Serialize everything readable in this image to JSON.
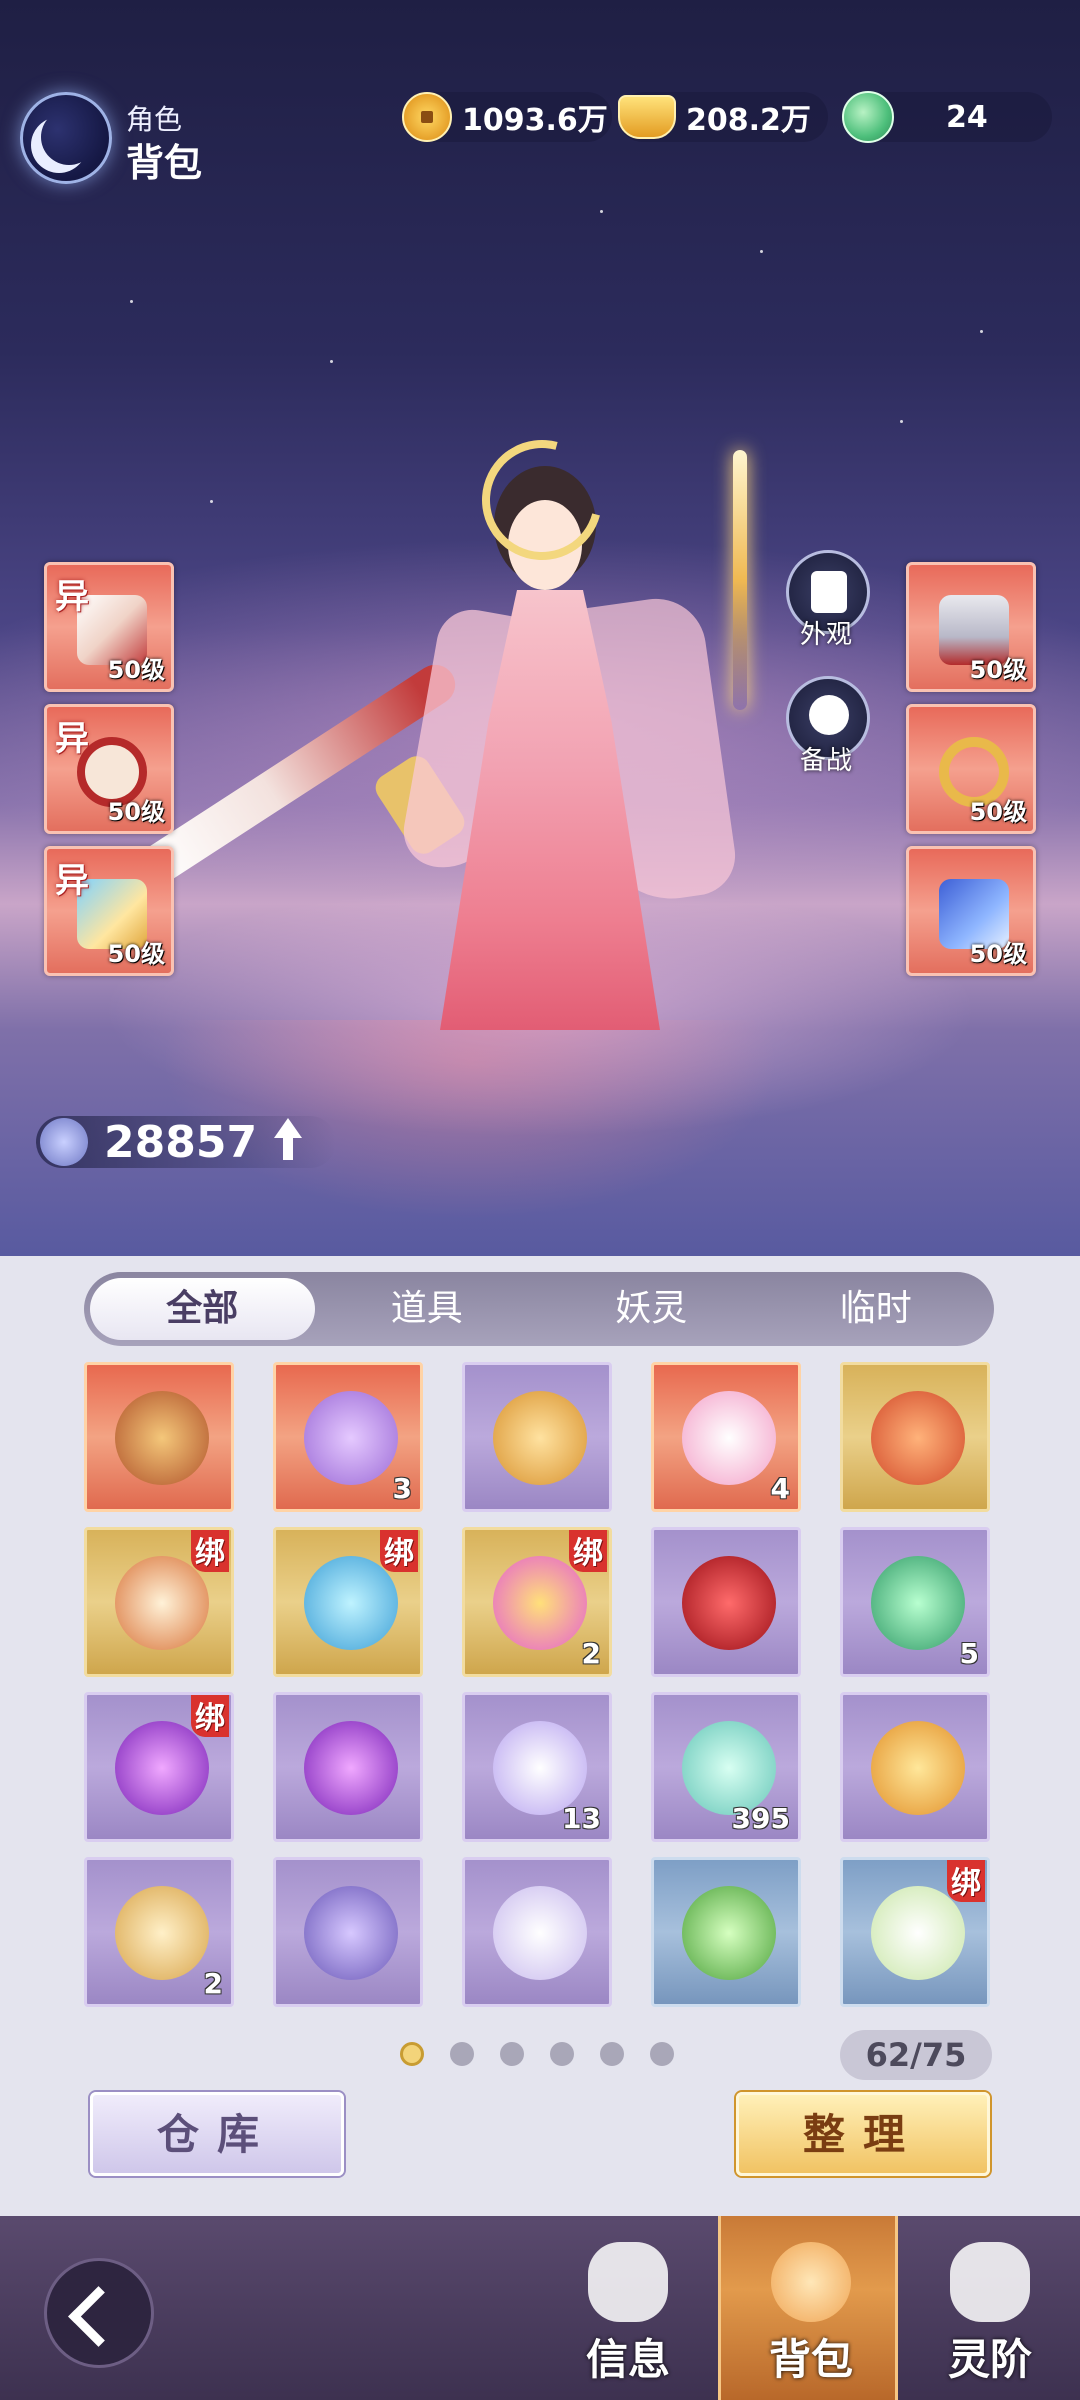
{
  "header": {
    "subtitle": "角色",
    "title": "背包"
  },
  "currencies": [
    {
      "icon": "copper-coin-icon",
      "value": "1093.6万"
    },
    {
      "icon": "gold-ingot-icon",
      "value": "208.2万"
    },
    {
      "icon": "jade-dragon-icon",
      "value": "24"
    }
  ],
  "equipment": {
    "left": [
      {
        "tag": "异",
        "level": "50级",
        "icon": "sword-charm-icon"
      },
      {
        "tag": "异",
        "level": "50级",
        "icon": "bead-necklace-icon"
      },
      {
        "tag": "异",
        "level": "50级",
        "icon": "feather-hairpin-icon"
      }
    ],
    "right": [
      {
        "level": "50级",
        "icon": "armor-robe-icon"
      },
      {
        "level": "50级",
        "icon": "gold-ring-icon"
      },
      {
        "level": "50级",
        "icon": "blue-boots-icon"
      }
    ]
  },
  "side_buttons": {
    "appearance": "外观",
    "battle_prep": "备战"
  },
  "power": "28857",
  "tabs": [
    "全部",
    "道具",
    "妖灵",
    "临时"
  ],
  "active_tab": "全部",
  "items": [
    {
      "icon": "treasure-chest-icon",
      "rarity": "red",
      "count": "",
      "bound": ""
    },
    {
      "icon": "lucky-bag-icon",
      "rarity": "red",
      "count": "3",
      "bound": ""
    },
    {
      "icon": "fate-token-icon",
      "rarity": "purple",
      "count": "",
      "bound": ""
    },
    {
      "icon": "crane-bird-icon",
      "rarity": "red",
      "count": "4",
      "bound": ""
    },
    {
      "icon": "voucher-ticket-icon",
      "rarity": "gold",
      "count": "",
      "bound": ""
    },
    {
      "icon": "card-icon",
      "rarity": "gold",
      "count": "",
      "bound": "绑"
    },
    {
      "icon": "blue-orb-icon",
      "rarity": "gold",
      "count": "",
      "bound": "绑"
    },
    {
      "icon": "rainbow-peach-icon",
      "rarity": "gold",
      "count": "2",
      "bound": "绑"
    },
    {
      "icon": "red-rose-icon",
      "rarity": "purple",
      "count": "",
      "bound": ""
    },
    {
      "icon": "jade-orb-icon",
      "rarity": "purple",
      "count": "5",
      "bound": ""
    },
    {
      "icon": "crystal-ball-icon",
      "rarity": "purple",
      "count": "",
      "bound": "绑"
    },
    {
      "icon": "crystal-ball-icon",
      "rarity": "purple",
      "count": "",
      "bound": ""
    },
    {
      "icon": "lotus-flower-icon",
      "rarity": "purple",
      "count": "13",
      "bound": ""
    },
    {
      "icon": "potion-bottle-icon",
      "rarity": "purple",
      "count": "395",
      "bound": ""
    },
    {
      "icon": "amber-crystal-icon",
      "rarity": "purple",
      "count": "",
      "bound": ""
    },
    {
      "icon": "royal-plaque-icon",
      "rarity": "purple",
      "count": "2",
      "bound": ""
    },
    {
      "icon": "book-icon",
      "rarity": "purple",
      "count": "",
      "bound": ""
    },
    {
      "icon": "scroll-icon",
      "rarity": "purple",
      "count": "",
      "bound": ""
    },
    {
      "icon": "bamboo-flute-icon",
      "rarity": "blue",
      "count": "",
      "bound": ""
    },
    {
      "icon": "white-lily-icon",
      "rarity": "blue",
      "count": "",
      "bound": "绑"
    }
  ],
  "pagination": {
    "pages": 6,
    "current": 1
  },
  "capacity": "62/75",
  "buttons": {
    "warehouse": "仓库",
    "sort": "整理"
  },
  "nav": [
    {
      "label": "信息",
      "icon": "fist-icon",
      "active": false
    },
    {
      "label": "背包",
      "icon": "bag-icon",
      "active": true
    },
    {
      "label": "灵阶",
      "icon": "flame-icon",
      "active": false
    }
  ],
  "colors": {
    "rarity_red": "#e8694f",
    "rarity_gold": "#d8b25a",
    "rarity_purple": "#a491cc",
    "rarity_blue": "#7e9fc6",
    "bind_badge": "#d9322e"
  }
}
